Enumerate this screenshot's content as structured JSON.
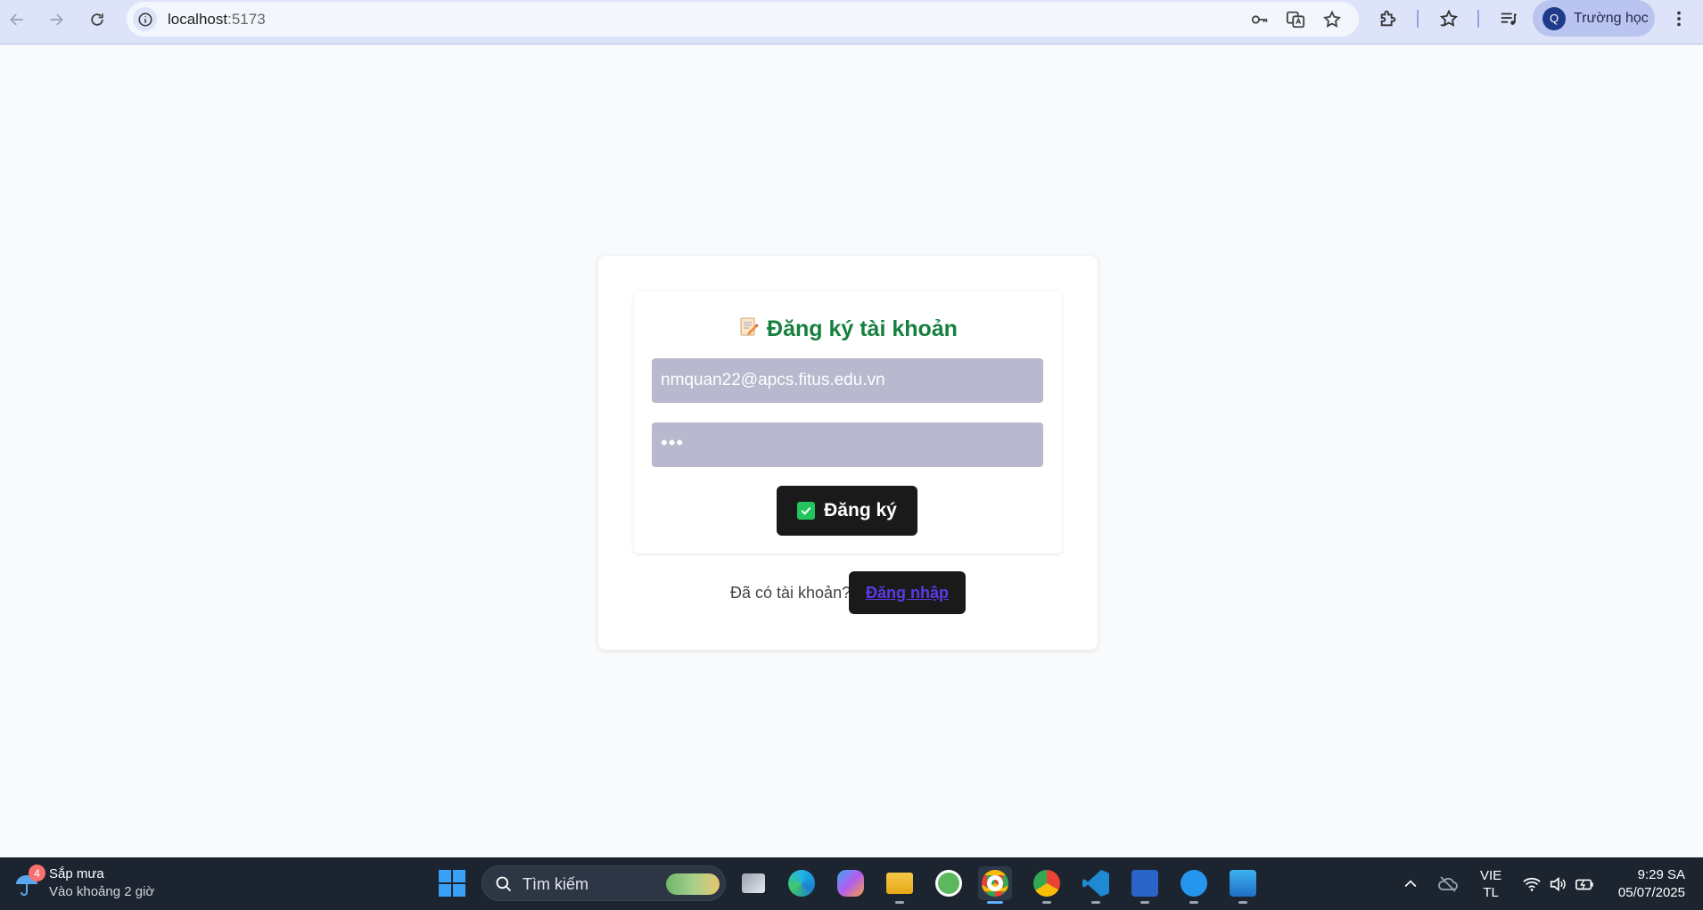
{
  "browser": {
    "url_host": "localhost",
    "url_port": ":5173",
    "profile_initial": "Q",
    "profile_name": "Trường học"
  },
  "form": {
    "title": "Đăng ký tài khoản",
    "title_icon": "memo-icon",
    "email_value": "nmquan22@apcs.fitus.edu.vn",
    "password_value": "•••",
    "submit_label": "Đăng ký",
    "submit_icon": "check-box-icon",
    "login_prompt": "Đã có tài khoản?",
    "login_label": "Đăng nhập"
  },
  "taskbar": {
    "weather_badge": "4",
    "weather_title": "Sắp mưa",
    "weather_subtitle": "Vào khoảng 2 giờ",
    "search_placeholder": "Tìm kiếm",
    "language_top": "VIE",
    "language_bottom": "TL",
    "time": "9:29 SA",
    "date": "05/07/2025"
  },
  "colors": {
    "title_green": "#15803d",
    "field_bg": "#b8b8cf",
    "button_bg": "#1a1a1a",
    "link_purple": "#5b3ae6"
  }
}
